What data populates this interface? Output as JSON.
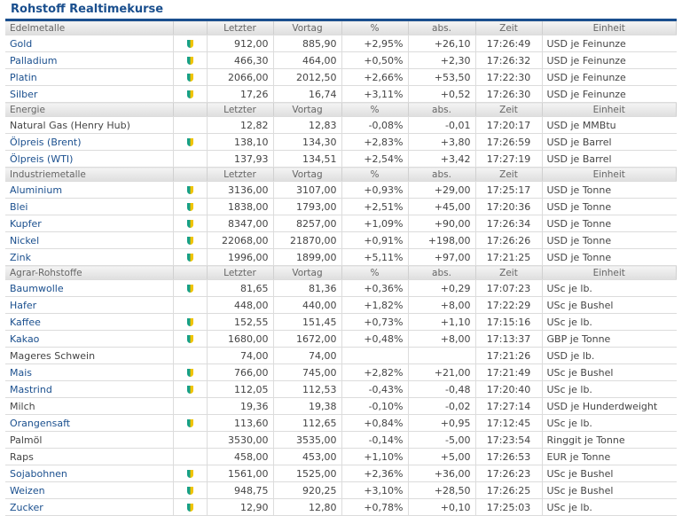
{
  "title": "Rohstoff Realtimekurse",
  "headers": {
    "letzter": "Letzter",
    "vortag": "Vortag",
    "pct": "%",
    "abs": "abs.",
    "zeit": "Zeit",
    "einheit": "Einheit"
  },
  "groups": [
    {
      "name": "Edelmetalle",
      "rows": [
        [
          "Gold",
          true,
          true,
          "912,00",
          "885,90",
          "+2,95%",
          "+26,10",
          "17:26:49",
          "USD je Feinunze"
        ],
        [
          "Palladium",
          true,
          true,
          "466,30",
          "464,00",
          "+0,50%",
          "+2,30",
          "17:26:32",
          "USD je Feinunze"
        ],
        [
          "Platin",
          true,
          true,
          "2066,00",
          "2012,50",
          "+2,66%",
          "+53,50",
          "17:22:30",
          "USD je Feinunze"
        ],
        [
          "Silber",
          true,
          true,
          "17,26",
          "16,74",
          "+3,11%",
          "+0,52",
          "17:26:30",
          "USD je Feinunze"
        ]
      ]
    },
    {
      "name": "Energie",
      "rows": [
        [
          "Natural Gas (Henry Hub)",
          false,
          false,
          "12,82",
          "12,83",
          "-0,08%",
          "-0,01",
          "17:20:17",
          "USD je MMBtu"
        ],
        [
          "Ölpreis (Brent)",
          true,
          true,
          "138,10",
          "134,30",
          "+2,83%",
          "+3,80",
          "17:26:59",
          "USD je Barrel"
        ],
        [
          "Ölpreis (WTI)",
          true,
          false,
          "137,93",
          "134,51",
          "+2,54%",
          "+3,42",
          "17:27:19",
          "USD je Barrel"
        ]
      ]
    },
    {
      "name": "Industriemetalle",
      "rows": [
        [
          "Aluminium",
          true,
          true,
          "3136,00",
          "3107,00",
          "+0,93%",
          "+29,00",
          "17:25:17",
          "USD je Tonne"
        ],
        [
          "Blei",
          true,
          true,
          "1838,00",
          "1793,00",
          "+2,51%",
          "+45,00",
          "17:20:36",
          "USD je Tonne"
        ],
        [
          "Kupfer",
          true,
          true,
          "8347,00",
          "8257,00",
          "+1,09%",
          "+90,00",
          "17:26:34",
          "USD je Tonne"
        ],
        [
          "Nickel",
          true,
          true,
          "22068,00",
          "21870,00",
          "+0,91%",
          "+198,00",
          "17:26:26",
          "USD je Tonne"
        ],
        [
          "Zink",
          true,
          true,
          "1996,00",
          "1899,00",
          "+5,11%",
          "+97,00",
          "17:21:25",
          "USD je Tonne"
        ]
      ]
    },
    {
      "name": "Agrar-Rohstoffe",
      "rows": [
        [
          "Baumwolle",
          true,
          true,
          "81,65",
          "81,36",
          "+0,36%",
          "+0,29",
          "17:07:23",
          "USc je lb."
        ],
        [
          "Hafer",
          true,
          false,
          "448,00",
          "440,00",
          "+1,82%",
          "+8,00",
          "17:22:29",
          "USc je Bushel"
        ],
        [
          "Kaffee",
          true,
          true,
          "152,55",
          "151,45",
          "+0,73%",
          "+1,10",
          "17:15:16",
          "USc je lb."
        ],
        [
          "Kakao",
          true,
          true,
          "1680,00",
          "1672,00",
          "+0,48%",
          "+8,00",
          "17:13:37",
          "GBP je Tonne"
        ],
        [
          "Mageres Schwein",
          false,
          false,
          "74,00",
          "74,00",
          "",
          "",
          "17:21:26",
          "USD je lb."
        ],
        [
          "Mais",
          true,
          true,
          "766,00",
          "745,00",
          "+2,82%",
          "+21,00",
          "17:21:49",
          "USc je Bushel"
        ],
        [
          "Mastrind",
          true,
          true,
          "112,05",
          "112,53",
          "-0,43%",
          "-0,48",
          "17:20:40",
          "USc je lb."
        ],
        [
          "Milch",
          false,
          false,
          "19,36",
          "19,38",
          "-0,10%",
          "-0,02",
          "17:27:14",
          "USD je Hunderdweight"
        ],
        [
          "Orangensaft",
          true,
          true,
          "113,60",
          "112,65",
          "+0,84%",
          "+0,95",
          "17:12:45",
          "USc je lb."
        ],
        [
          "Palmöl",
          false,
          false,
          "3530,00",
          "3535,00",
          "-0,14%",
          "-5,00",
          "17:23:54",
          "Ringgit je Tonne"
        ],
        [
          "Raps",
          false,
          false,
          "458,00",
          "453,00",
          "+1,10%",
          "+5,00",
          "17:26:53",
          "EUR je Tonne"
        ],
        [
          "Sojabohnen",
          true,
          true,
          "1561,00",
          "1525,00",
          "+2,36%",
          "+36,00",
          "17:26:23",
          "USc je Bushel"
        ],
        [
          "Weizen",
          true,
          true,
          "948,75",
          "920,25",
          "+3,10%",
          "+28,50",
          "17:26:25",
          "USc je Bushel"
        ],
        [
          "Zucker",
          true,
          true,
          "12,90",
          "12,80",
          "+0,78%",
          "+0,10",
          "17:25:03",
          "USc je lb."
        ]
      ]
    }
  ]
}
